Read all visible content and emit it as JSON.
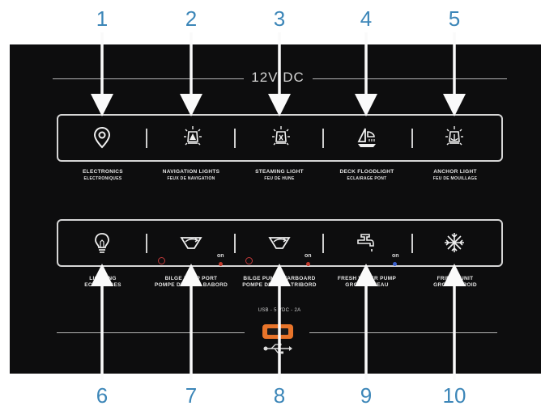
{
  "callouts": {
    "top": [
      "1",
      "2",
      "3",
      "4",
      "5"
    ],
    "bottom": [
      "6",
      "7",
      "8",
      "9",
      "10"
    ]
  },
  "panel": {
    "voltage_label": "12V DC"
  },
  "top_row": [
    {
      "name": "electronics",
      "icon": "location-pin-icon",
      "label": "ELECTRONICS",
      "sublabel": "ELECTRONIQUES"
    },
    {
      "name": "navigation-lights",
      "icon": "nav-light-icon",
      "label": "NAVIGATION LIGHTS",
      "sublabel": "FEUX DE NAVIGATION"
    },
    {
      "name": "steaming-light",
      "icon": "steaming-light-icon",
      "label": "STEAMING LIGHT",
      "sublabel": "FEU DE HUNE"
    },
    {
      "name": "deck-floodlight",
      "icon": "deck-floodlight-icon",
      "label": "DECK FLOODLIGHT",
      "sublabel": "ECLAIRAGE PONT"
    },
    {
      "name": "anchor-light",
      "icon": "anchor-light-icon",
      "label": "ANCHOR LIGHT",
      "sublabel": "FEU DE MOUILLAGE"
    }
  ],
  "bottom_row": [
    {
      "name": "lighting",
      "icon": "light-bulb-icon",
      "label": "LIGHTING",
      "sublabel": "ECLAIRAGES"
    },
    {
      "name": "bilge-pump-port",
      "icon": "bilge-pump-icon",
      "label": "BILGE PUMP PORT",
      "sublabel": "POMPE DE CALE BABORD",
      "indicator": "on"
    },
    {
      "name": "bilge-pump-starboard",
      "icon": "bilge-pump-icon",
      "label": "BILGE PUMP STARBOARD",
      "sublabel": "POMPE DE CALE TRIBORD",
      "indicator": "on"
    },
    {
      "name": "fresh-water-pump",
      "icon": "faucet-icon",
      "label": "FRESH WATER PUMP",
      "sublabel": "GROUPE D'EAU",
      "indicator": "on"
    },
    {
      "name": "fridge-unit",
      "icon": "snowflake-icon",
      "label": "FRIDGE UNIT",
      "sublabel": "GROUPE FROID"
    }
  ],
  "usb": {
    "label": "USB - 5 VDC - 2A",
    "icon": "usb-icon"
  },
  "colors": {
    "callout": "#3c86b8",
    "panel": "#0d0d0e",
    "led_red": "#c0392b",
    "led_blue": "#3a5fcd"
  }
}
